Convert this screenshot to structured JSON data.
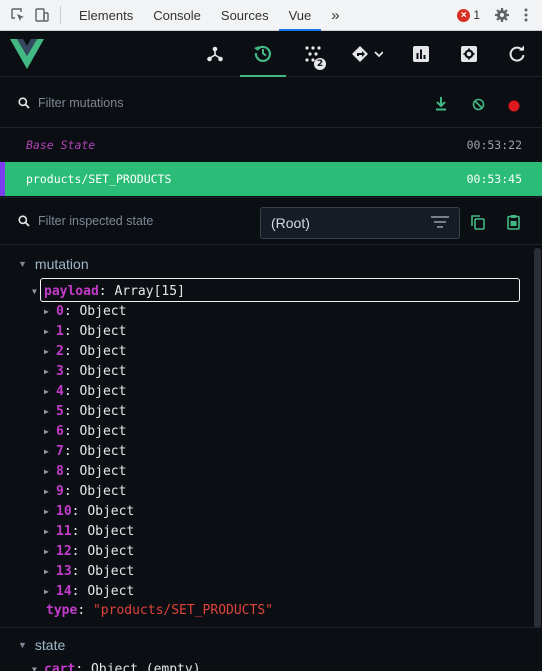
{
  "devtools": {
    "tabs": [
      "Elements",
      "Console",
      "Sources",
      "Vue"
    ],
    "active_tab": "Vue",
    "more_label": "»",
    "error_count": "1"
  },
  "toolbar": {
    "icons": [
      "components-icon",
      "vuex-history-icon",
      "events-icon",
      "router-icon",
      "performance-icon",
      "settings-icon",
      "refresh-icon"
    ],
    "events_badge": "2",
    "active": "vuex-history-icon",
    "accent": "#42b983"
  },
  "mutations": {
    "filter_placeholder": "Filter mutations",
    "items": [
      {
        "name": "Base State",
        "time": "00:53:22"
      },
      {
        "name": "products/SET_PRODUCTS",
        "time": "00:53:45"
      }
    ],
    "active_color": "#2bbd77"
  },
  "inspector": {
    "filter_placeholder": "Filter inspected state",
    "select_value": "(Root)",
    "mutation_section": "mutation",
    "payload_key": "payload",
    "payload_value": "Array[15]",
    "items": [
      "0",
      "1",
      "2",
      "3",
      "4",
      "5",
      "6",
      "7",
      "8",
      "9",
      "10",
      "11",
      "12",
      "13",
      "14"
    ],
    "item_type": "Object",
    "type_key": "type",
    "type_value": "\"products/SET_PRODUCTS\"",
    "state_section": "state",
    "state_first_key": "cart",
    "state_first_value": "Object (empty)"
  }
}
